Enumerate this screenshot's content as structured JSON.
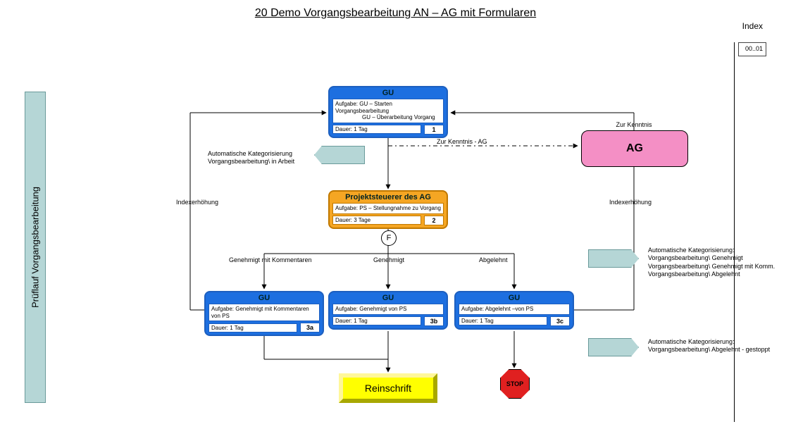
{
  "title": "20  Demo Vorgangsbearbeitung AN – AG mit Formularen",
  "index": {
    "label": "Index",
    "value": "00..01"
  },
  "sidebar": "Prüflauf Vorgangsbearbeitung",
  "top_box": {
    "header": "GU",
    "task_l1": "Aufgabe:  GU – Starten Vorgangsbearbeitung",
    "task_l2": "GU – Überarbeitung Vorgang",
    "duration": "Dauer: 1 Tag",
    "num": "1"
  },
  "mid_box": {
    "header": "Projektsteuerer des AG",
    "task": "Aufgabe:   PS  – Stellungnahme zu Vorgang",
    "duration": "Dauer: 3 Tage",
    "num": "2"
  },
  "b3a": {
    "header": "GU",
    "task": "Aufgabe: Genehmigt mit Kommentaren von PS",
    "duration": "Dauer: 1 Tag",
    "num": "3a"
  },
  "b3b": {
    "header": "GU",
    "task": "Aufgabe: Genehmigt von PS",
    "duration": "Dauer: 1 Tag",
    "num": "3b"
  },
  "b3c": {
    "header": "GU",
    "task": "Aufgabe:  Abgelehnt –von PS",
    "duration": "Dauer: 1 Tag",
    "num": "3c"
  },
  "ag": {
    "caption": "Zur Kenntnis",
    "label": "AG"
  },
  "decision": "F",
  "reinschrift": "Reinschrift",
  "stop": "STOP",
  "labels": {
    "zur_kenntnis_ag": "Zur Kenntnis - AG",
    "auto_kat": "Automatische Kategorisierung",
    "in_arbeit": "Vorgangsbearbeitung\\ in Arbeit",
    "index_erh_l": "Indexerhöhung",
    "index_erh_r": "Indexerhöhung",
    "branch_a": "Genehmigt mit Kommentaren",
    "branch_b": "Genehmigt",
    "branch_c": "Abgelehnt",
    "right1_l1": "Automatische Kategorisierung:",
    "right1_l2": "Vorgangsbearbeitung\\ Genehmigt",
    "right1_l3": "Vorgangsbearbeitung\\ Genehmigt mit Komm.",
    "right1_l4": "Vorgangsbearbeitung\\ Abgelehnt",
    "right2_l1": "Automatische Kategorisierung:",
    "right2_l2": "Vorgangsbearbeitung\\ Abgelehnt - gestoppt"
  }
}
